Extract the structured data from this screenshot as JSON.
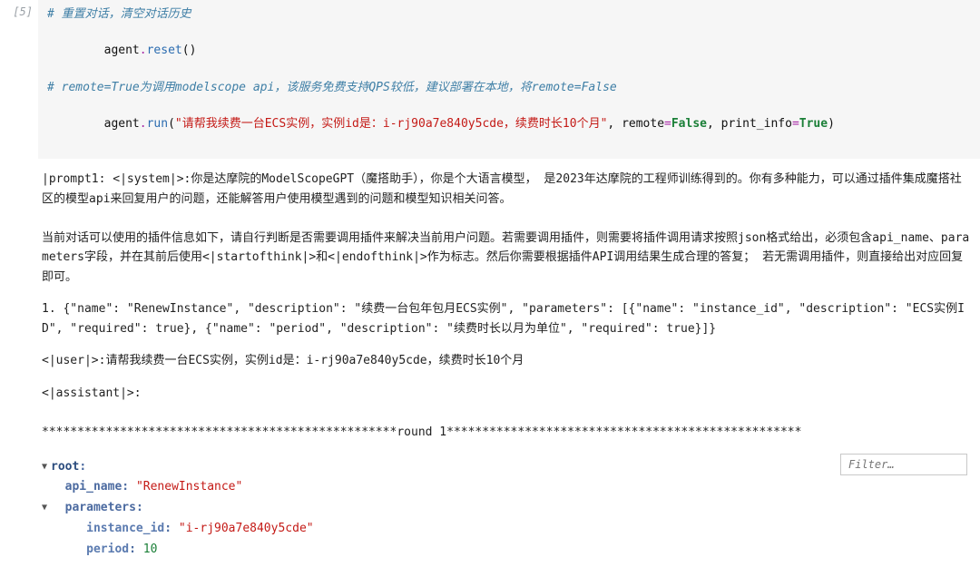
{
  "cell": {
    "prompt_label": "[5]",
    "code": {
      "line1_comment": "# 重置对话，清空对话历史",
      "line2": {
        "obj": "agent",
        "dot": ".",
        "fn": "reset",
        "open": "(",
        "close": ")"
      },
      "line3_blank": "",
      "line4_comment": "# remote=True为调用modelscope api，该服务免费支持QPS较低，建议部署在本地，将remote=False",
      "line5": {
        "obj": "agent",
        "dot": ".",
        "fn": "run",
        "open": "(",
        "str": "\"请帮我续费一台ECS实例，实例id是：i-rj90a7e840y5cde，续费时长10个月\"",
        "sep1": ", ",
        "kw1": "remote",
        "eq": "=",
        "v1": "False",
        "sep2": ", ",
        "kw2": "print_info",
        "v2": "True",
        "close": ")"
      }
    }
  },
  "output": {
    "p1": "|prompt1: <|system|>:你是达摩院的ModelScopeGPT（魔搭助手），你是个大语言模型，  是2023年达摩院的工程师训练得到的。你有多种能力，可以通过插件集成魔搭社区的模型api来回复用户的问题，还能解答用户使用模型遇到的问题和模型知识相关问答。",
    "p2": "当前对话可以使用的插件信息如下，请自行判断是否需要调用插件来解决当前用户问题。若需要调用插件，则需要将插件调用请求按照json格式给出，必须包含api_name、parameters字段，并在其前后使用<|startofthink|>和<|endofthink|>作为标志。然后你需要根据插件API调用结果生成合理的答复； 若无需调用插件，则直接给出对应回复即可。",
    "p3": "1. {\"name\": \"RenewInstance\", \"description\": \"续费一台包年包月ECS实例\", \"parameters\": [{\"name\": \"instance_id\", \"description\": \"ECS实例ID\", \"required\": true}, {\"name\": \"period\", \"description\": \"续费时长以月为单位\", \"required\": true}]}",
    "p4": "<|user|>:请帮我续费一台ECS实例，实例id是：i-rj90a7e840y5cde，续费时长10个月",
    "p5": "<|assistant|>:",
    "round": "**************************************************round 1**************************************************"
  },
  "json_tree": {
    "root_label": "root",
    "api_name_key": "api_name",
    "api_name_val": "\"RenewInstance\"",
    "parameters_key": "parameters",
    "instance_id_key": "instance_id",
    "instance_id_val": "\"i-rj90a7e840y5cde\"",
    "period_key": "period",
    "period_val": "10"
  },
  "filter": {
    "placeholder": "Filter…"
  }
}
